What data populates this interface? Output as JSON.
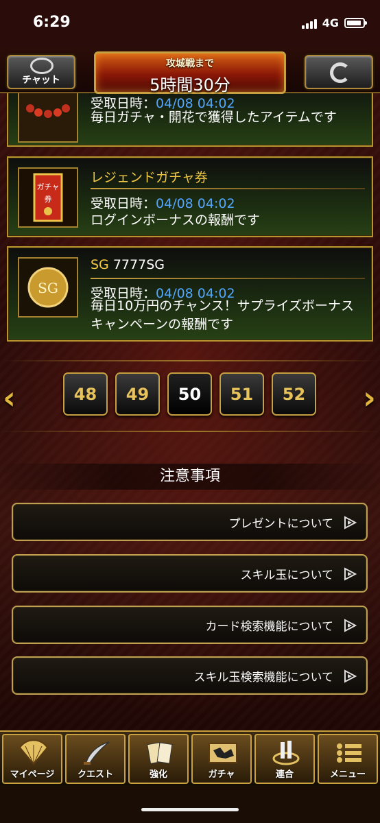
{
  "status_bar": {
    "time": "6:29",
    "network": "4G"
  },
  "header": {
    "chat_label": "チャット",
    "siege_title": "攻城戦まで",
    "siege_time": "5時間30分"
  },
  "items": [
    {
      "name": "",
      "date_label": "受取日時：",
      "date_value": "04/08 04:02",
      "description": "毎日ガチャ・開花で獲得したアイテムです"
    },
    {
      "name": "レジェンドガチャ券",
      "date_label": "受取日時：",
      "date_value": "04/08 04:02",
      "description": "ログインボーナスの報酬です"
    },
    {
      "name_prefix": "SG",
      "name": "7777SG",
      "icon_text": "SG",
      "date_label": "受取日時：",
      "date_value": "04/08 04:02",
      "description": "毎日10万円のチャンス！サプライズボーナスキャンペーンの報酬です"
    }
  ],
  "pagination": {
    "pages": [
      "48",
      "49",
      "50",
      "51",
      "52"
    ],
    "current": "50",
    "prev_arrow": "‹",
    "next_arrow": "›"
  },
  "notes": {
    "title": "注意事項",
    "links": [
      "プレゼントについて",
      "スキル玉について",
      "カード検索機能について",
      "スキル玉検索機能について"
    ]
  },
  "bottom_nav": [
    {
      "label": "マイページ",
      "icon": "fan-icon"
    },
    {
      "label": "クエスト",
      "icon": "sword-icon"
    },
    {
      "label": "強化",
      "icon": "cards-icon"
    },
    {
      "label": "ガチャ",
      "icon": "map-icon"
    },
    {
      "label": "連合",
      "icon": "alliance-icon"
    },
    {
      "label": "メニュー",
      "icon": "menu-icon"
    }
  ],
  "colors": {
    "gold": "#c9a040",
    "date_blue": "#53a6ff",
    "item_name_yellow": "#f3c843"
  }
}
